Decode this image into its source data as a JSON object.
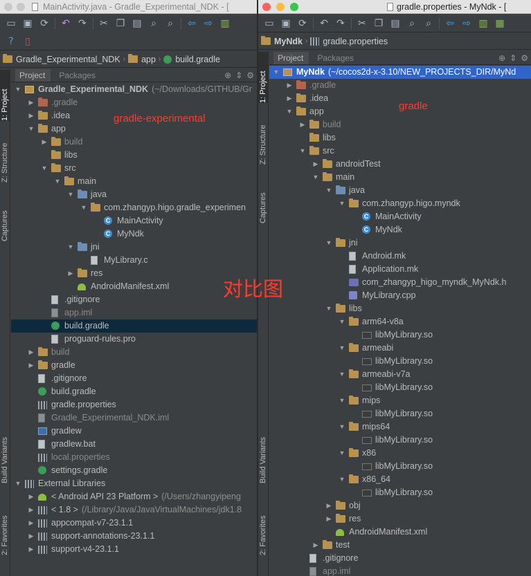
{
  "left": {
    "title": "MainActivity.java - Gradle_Experimental_NDK - [",
    "breadcrumbs": [
      "Gradle_Experimental_NDK",
      "app",
      "build.gradle"
    ],
    "sidebar_tabs": [
      "1: Project",
      "Z: Structure",
      "Captures",
      "Build Variants",
      "2: Favorites"
    ],
    "panel_tabs": [
      "Project",
      "Packages"
    ],
    "tree": [
      {
        "depth": 0,
        "arrow": "down",
        "icon": "mod",
        "label": "Gradle_Experimental_NDK",
        "dim": "(~/Downloads/GITHUB/Gr",
        "bold": true
      },
      {
        "depth": 1,
        "arrow": "right",
        "icon": "folder-red",
        "label": ".gradle",
        "muted": true
      },
      {
        "depth": 1,
        "arrow": "right",
        "icon": "folder",
        "label": ".idea"
      },
      {
        "depth": 1,
        "arrow": "down",
        "icon": "folder",
        "label": "app"
      },
      {
        "depth": 2,
        "arrow": "right",
        "icon": "folder",
        "label": "build",
        "muted": true
      },
      {
        "depth": 2,
        "arrow": "",
        "icon": "folder",
        "label": "libs"
      },
      {
        "depth": 2,
        "arrow": "down",
        "icon": "folder",
        "label": "src"
      },
      {
        "depth": 3,
        "arrow": "down",
        "icon": "folder",
        "label": "main"
      },
      {
        "depth": 4,
        "arrow": "down",
        "icon": "folder-blue",
        "label": "java"
      },
      {
        "depth": 5,
        "arrow": "down",
        "icon": "folder",
        "label": "com.zhangyp.higo.gradle_experimen"
      },
      {
        "depth": 6,
        "arrow": "",
        "icon": "class",
        "label": "MainActivity"
      },
      {
        "depth": 6,
        "arrow": "",
        "icon": "class",
        "label": "MyNdk"
      },
      {
        "depth": 4,
        "arrow": "down",
        "icon": "folder-blue",
        "label": "jni"
      },
      {
        "depth": 5,
        "arrow": "",
        "icon": "file",
        "label": "MyLibrary.c"
      },
      {
        "depth": 4,
        "arrow": "right",
        "icon": "folder",
        "label": "res"
      },
      {
        "depth": 4,
        "arrow": "",
        "icon": "android",
        "label": "AndroidManifest.xml"
      },
      {
        "depth": 2,
        "arrow": "",
        "icon": "file",
        "label": ".gitignore"
      },
      {
        "depth": 2,
        "arrow": "",
        "icon": "file-dark",
        "label": "app.iml",
        "muted": true
      },
      {
        "depth": 2,
        "arrow": "",
        "icon": "gradle",
        "label": "build.gradle",
        "selected": true
      },
      {
        "depth": 2,
        "arrow": "",
        "icon": "file",
        "label": "proguard-rules.pro"
      },
      {
        "depth": 1,
        "arrow": "right",
        "icon": "folder",
        "label": "build",
        "muted": true
      },
      {
        "depth": 1,
        "arrow": "right",
        "icon": "folder",
        "label": "gradle"
      },
      {
        "depth": 1,
        "arrow": "",
        "icon": "file",
        "label": ".gitignore"
      },
      {
        "depth": 1,
        "arrow": "",
        "icon": "gradle",
        "label": "build.gradle"
      },
      {
        "depth": 1,
        "arrow": "",
        "icon": "bars",
        "label": "gradle.properties"
      },
      {
        "depth": 1,
        "arrow": "",
        "icon": "file-dark",
        "label": "Gradle_Experimental_NDK.iml",
        "muted": true
      },
      {
        "depth": 1,
        "arrow": "",
        "icon": "term",
        "label": "gradlew"
      },
      {
        "depth": 1,
        "arrow": "",
        "icon": "file",
        "label": "gradlew.bat"
      },
      {
        "depth": 1,
        "arrow": "",
        "icon": "bars",
        "label": "local.properties",
        "muted": true
      },
      {
        "depth": 1,
        "arrow": "",
        "icon": "gradle",
        "label": "settings.gradle"
      },
      {
        "depth": 0,
        "arrow": "down",
        "icon": "bars",
        "label": "External Libraries"
      },
      {
        "depth": 1,
        "arrow": "right",
        "icon": "android",
        "label": "< Android API 23 Platform >",
        "dim": "(/Users/zhangyipeng"
      },
      {
        "depth": 1,
        "arrow": "right",
        "icon": "bars",
        "label": "< 1.8 >",
        "dim": "(/Library/Java/JavaVirtualMachines/jdk1.8"
      },
      {
        "depth": 1,
        "arrow": "right",
        "icon": "bars",
        "label": "appcompat-v7-23.1.1"
      },
      {
        "depth": 1,
        "arrow": "right",
        "icon": "bars",
        "label": "support-annotations-23.1.1"
      },
      {
        "depth": 1,
        "arrow": "right",
        "icon": "bars",
        "label": "support-v4-23.1.1"
      }
    ]
  },
  "right": {
    "title": "gradle.properties - MyNdk - [",
    "breadcrumbs": [
      "MyNdk",
      "gradle.properties"
    ],
    "sidebar_tabs": [
      "1: Project",
      "Z: Structure",
      "Captures",
      "Build Variants",
      "2: Favorites"
    ],
    "panel_tabs": [
      "Project",
      "Packages"
    ],
    "tree": [
      {
        "depth": 0,
        "arrow": "down",
        "icon": "mod",
        "label": "MyNdk",
        "dim": "(~/cocos2d-x-3.10/NEW_PROJECTS_DIR/MyNd",
        "bold": true,
        "focused": true
      },
      {
        "depth": 1,
        "arrow": "right",
        "icon": "folder-red",
        "label": ".gradle",
        "muted": true
      },
      {
        "depth": 1,
        "arrow": "right",
        "icon": "folder",
        "label": ".idea"
      },
      {
        "depth": 1,
        "arrow": "down",
        "icon": "folder",
        "label": "app"
      },
      {
        "depth": 2,
        "arrow": "right",
        "icon": "folder",
        "label": "build",
        "muted": true
      },
      {
        "depth": 2,
        "arrow": "",
        "icon": "folder",
        "label": "libs"
      },
      {
        "depth": 2,
        "arrow": "down",
        "icon": "folder",
        "label": "src"
      },
      {
        "depth": 3,
        "arrow": "right",
        "icon": "folder",
        "label": "androidTest"
      },
      {
        "depth": 3,
        "arrow": "down",
        "icon": "folder",
        "label": "main"
      },
      {
        "depth": 4,
        "arrow": "down",
        "icon": "folder-blue",
        "label": "java"
      },
      {
        "depth": 5,
        "arrow": "down",
        "icon": "folder",
        "label": "com.zhangyp.higo.myndk"
      },
      {
        "depth": 6,
        "arrow": "",
        "icon": "class",
        "label": "MainActivity"
      },
      {
        "depth": 6,
        "arrow": "",
        "icon": "class",
        "label": "MyNdk"
      },
      {
        "depth": 4,
        "arrow": "down",
        "icon": "folder",
        "label": "jni"
      },
      {
        "depth": 5,
        "arrow": "",
        "icon": "file",
        "label": "Android.mk"
      },
      {
        "depth": 5,
        "arrow": "",
        "icon": "file",
        "label": "Application.mk"
      },
      {
        "depth": 5,
        "arrow": "",
        "icon": "header",
        "label": "com_zhangyp_higo_myndk_MyNdk.h"
      },
      {
        "depth": 5,
        "arrow": "",
        "icon": "cpp",
        "label": "MyLibrary.cpp"
      },
      {
        "depth": 4,
        "arrow": "down",
        "icon": "folder",
        "label": "libs"
      },
      {
        "depth": 5,
        "arrow": "down",
        "icon": "folder",
        "label": "arm64-v8a"
      },
      {
        "depth": 6,
        "arrow": "",
        "icon": "lib",
        "label": "libMyLibrary.so"
      },
      {
        "depth": 5,
        "arrow": "down",
        "icon": "folder",
        "label": "armeabi"
      },
      {
        "depth": 6,
        "arrow": "",
        "icon": "lib",
        "label": "libMyLibrary.so"
      },
      {
        "depth": 5,
        "arrow": "down",
        "icon": "folder",
        "label": "armeabi-v7a"
      },
      {
        "depth": 6,
        "arrow": "",
        "icon": "lib",
        "label": "libMyLibrary.so"
      },
      {
        "depth": 5,
        "arrow": "down",
        "icon": "folder",
        "label": "mips"
      },
      {
        "depth": 6,
        "arrow": "",
        "icon": "lib",
        "label": "libMyLibrary.so"
      },
      {
        "depth": 5,
        "arrow": "down",
        "icon": "folder",
        "label": "mips64"
      },
      {
        "depth": 6,
        "arrow": "",
        "icon": "lib",
        "label": "libMyLibrary.so"
      },
      {
        "depth": 5,
        "arrow": "down",
        "icon": "folder",
        "label": "x86"
      },
      {
        "depth": 6,
        "arrow": "",
        "icon": "lib",
        "label": "libMyLibrary.so"
      },
      {
        "depth": 5,
        "arrow": "down",
        "icon": "folder",
        "label": "x86_64"
      },
      {
        "depth": 6,
        "arrow": "",
        "icon": "lib",
        "label": "libMyLibrary.so"
      },
      {
        "depth": 4,
        "arrow": "right",
        "icon": "folder",
        "label": "obj"
      },
      {
        "depth": 4,
        "arrow": "right",
        "icon": "folder",
        "label": "res"
      },
      {
        "depth": 4,
        "arrow": "",
        "icon": "android",
        "label": "AndroidManifest.xml"
      },
      {
        "depth": 3,
        "arrow": "right",
        "icon": "folder",
        "label": "test"
      },
      {
        "depth": 2,
        "arrow": "",
        "icon": "file",
        "label": ".gitignore"
      },
      {
        "depth": 2,
        "arrow": "",
        "icon": "file-dark",
        "label": "app.iml",
        "muted": true
      }
    ]
  },
  "annotations": {
    "gradle_experimental": "gradle-experimental",
    "gradle": "gradle",
    "compare": "对比图"
  },
  "colors": {
    "ide_bg": "#3c3f41",
    "selection": "#0d293e",
    "focus_selection": "#2f65ca",
    "annotation": "#ff3b2f",
    "folder": "#b8934f"
  }
}
